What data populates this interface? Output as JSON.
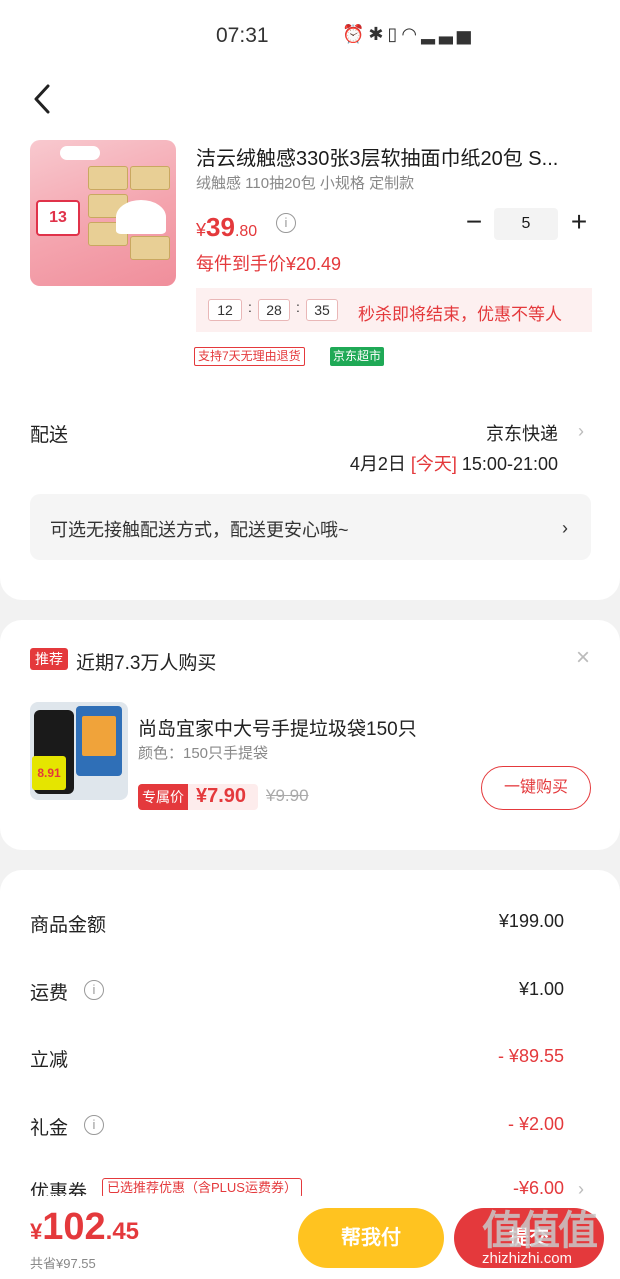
{
  "status_bar": {
    "time": "07:31",
    "icons": [
      "alarm-icon",
      "bluetooth-icon",
      "vibrate-icon",
      "wifi-icon",
      "signal-icon"
    ]
  },
  "product": {
    "title": "洁云绒触感330张3层软抽面巾纸20包 S...",
    "spec": "绒触感 110抽20包 小规格 定制款",
    "thumb_badge": "13",
    "price": {
      "symbol": "¥",
      "int": "39",
      "dec": ".80"
    },
    "quantity": "5",
    "unit_price": "每件到手价¥20.49",
    "countdown": {
      "h": "12",
      "m": "28",
      "s": "35",
      "sep": ":"
    },
    "countdown_text": "秒杀即将结束，优惠不等人",
    "tags": {
      "return": "支持7天无理由退货",
      "store": "京东超市"
    }
  },
  "delivery": {
    "label": "配送",
    "carrier": "京东快递",
    "date": "4月2日",
    "today": "[今天]",
    "time": "15:00-21:00",
    "contactless": "可选无接触配送方式，配送更安心哦~"
  },
  "recommend": {
    "tag": "推荐",
    "heading": "近期7.3万人购买",
    "title": "尚岛宜家中大号手提垃圾袋150只",
    "spec": "颜色：150只手提袋",
    "thumb_price": "8.91",
    "price_tag": "专属价",
    "price": "¥7.90",
    "old_price": "¥9.90",
    "buy_label": "一键购买"
  },
  "summary": {
    "rows": [
      {
        "label": "商品金额",
        "value": "¥199.00"
      },
      {
        "label": "运费",
        "value": "¥1.00"
      },
      {
        "label": "立减",
        "value": "- ¥89.55"
      },
      {
        "label": "礼金",
        "value": "- ¥2.00"
      },
      {
        "label": "优惠券",
        "value": "-¥6.00"
      }
    ],
    "coupon_note": "已选推荐优惠（含PLUS运费券）"
  },
  "bottom": {
    "total": {
      "symbol": "¥",
      "int": "102",
      "dec": ".45"
    },
    "saved": "共省¥97.55",
    "help_pay": "帮我付",
    "submit": "提交"
  },
  "watermark": {
    "logo": "值值值",
    "text": "zhizhizhi.com"
  },
  "colors": {
    "accent": "#e4393c",
    "help_pay": "#ffc320",
    "jd_supermarket": "#1fa956"
  }
}
